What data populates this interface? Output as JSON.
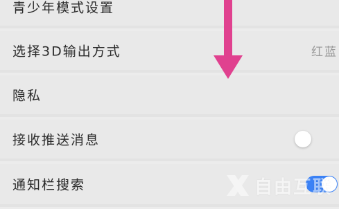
{
  "settings": {
    "items": [
      {
        "label": "青少年模式设置"
      },
      {
        "label": "选择3D输出方式",
        "value": "红蓝"
      },
      {
        "label": "隐私"
      },
      {
        "label": "接收推送消息",
        "toggle": "off"
      },
      {
        "label": "通知栏搜索",
        "toggle": "on"
      }
    ]
  },
  "annotation": {
    "arrow_color": "#e0418f",
    "arrow_direction": "down"
  },
  "watermark": {
    "text": "自由互联",
    "icon": "x-logo-icon"
  },
  "colors": {
    "toggle_on": "#3b82f6",
    "background": "#ececec"
  }
}
